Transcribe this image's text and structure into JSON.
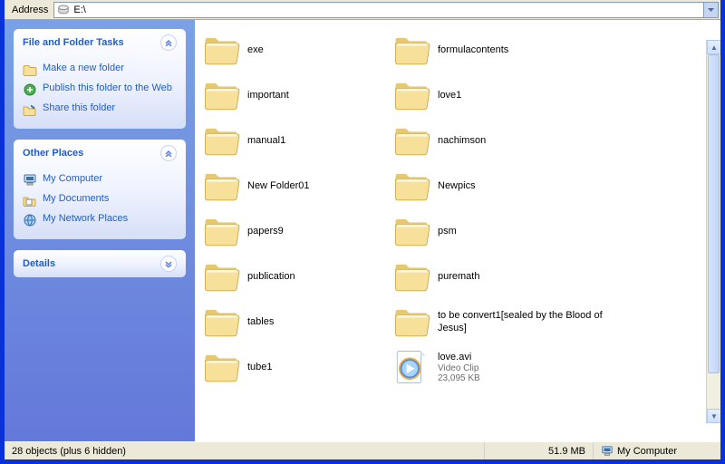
{
  "address": {
    "label": "Address",
    "value": "E:\\"
  },
  "sidebar": {
    "panels": [
      {
        "title": "File and Folder Tasks",
        "expanded": true,
        "items": [
          {
            "label": "Make a new folder",
            "icon": "new-folder"
          },
          {
            "label": "Publish this folder to the Web",
            "icon": "publish"
          },
          {
            "label": "Share this folder",
            "icon": "share"
          }
        ]
      },
      {
        "title": "Other Places",
        "expanded": true,
        "items": [
          {
            "label": "My Computer",
            "icon": "computer"
          },
          {
            "label": "My Documents",
            "icon": "documents"
          },
          {
            "label": "My Network Places",
            "icon": "network"
          }
        ]
      },
      {
        "title": "Details",
        "expanded": false,
        "items": []
      }
    ]
  },
  "items": [
    {
      "name": "exe",
      "type": "folder"
    },
    {
      "name": "formulacontents",
      "type": "folder"
    },
    {
      "name": "important",
      "type": "folder"
    },
    {
      "name": "love1",
      "type": "folder"
    },
    {
      "name": "manual1",
      "type": "folder"
    },
    {
      "name": "nachimson",
      "type": "folder"
    },
    {
      "name": "New Folder01",
      "type": "folder"
    },
    {
      "name": "Newpics",
      "type": "folder"
    },
    {
      "name": "papers9",
      "type": "folder"
    },
    {
      "name": "psm",
      "type": "folder"
    },
    {
      "name": "publication",
      "type": "folder"
    },
    {
      "name": "puremath",
      "type": "folder"
    },
    {
      "name": "tables",
      "type": "folder"
    },
    {
      "name": "to be convert1[sealed by the Blood of Jesus]",
      "type": "folder"
    },
    {
      "name": "tube1",
      "type": "folder"
    },
    {
      "name": "love.avi",
      "type": "video",
      "sub1": "Video Clip",
      "sub2": "23,095 KB"
    }
  ],
  "status": {
    "left": "28 objects (plus 6 hidden)",
    "size": "51.9 MB",
    "location": "My Computer"
  }
}
